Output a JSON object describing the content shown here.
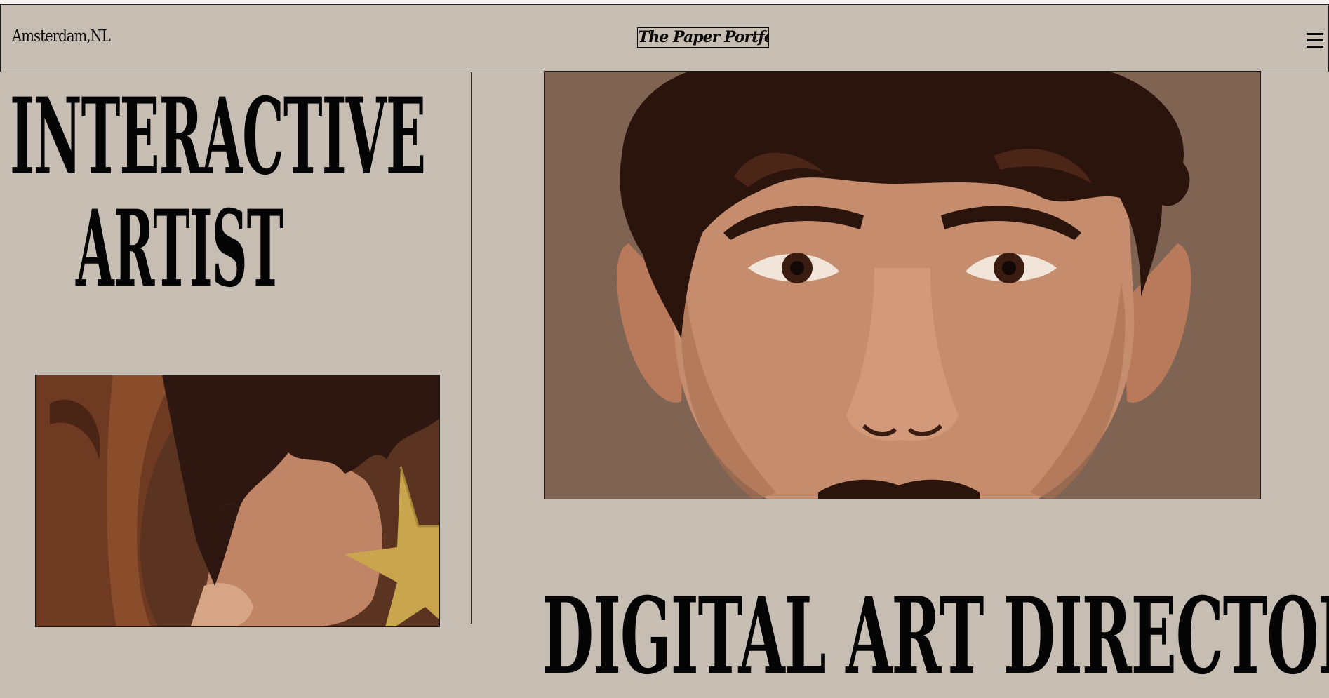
{
  "header": {
    "location": "Amsterdam,NL",
    "logo": "The Paper Portfolio",
    "menu_icon": "hamburger-menu-icon"
  },
  "hero": {
    "headline_line1": "INTERACTIVE",
    "headline_line2": "ARTIST",
    "subheading": "DIGITAL ART DIRECTOR"
  },
  "artworks": [
    {
      "name": "male-face-portrait-illustration"
    },
    {
      "name": "star-earring-portrait-illustration"
    }
  ],
  "colors": {
    "background": "#c6bdb3",
    "ink": "#0a0908",
    "portrait_background": "#806453",
    "skin": "#c58c6d",
    "hair": "#2a140c",
    "star": "#c9a64e"
  }
}
